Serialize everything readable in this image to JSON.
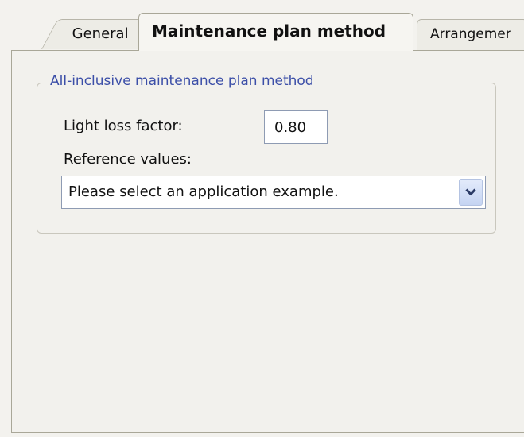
{
  "tabs": [
    {
      "label": "General",
      "active": false
    },
    {
      "label": "Maintenance plan method",
      "active": true
    },
    {
      "label": "Arrangemer",
      "active": false
    }
  ],
  "group": {
    "title": "All-inclusive maintenance plan method",
    "light_loss_factor_label": "Light loss factor:",
    "light_loss_factor_value": "0.80",
    "reference_values_label": "Reference values:",
    "reference_values_selected": "Please select an application example."
  },
  "icons": {
    "dropdown": "chevron-down-icon"
  },
  "colors": {
    "group_title": "#3c4fa8",
    "background": "#f2f1ed"
  }
}
